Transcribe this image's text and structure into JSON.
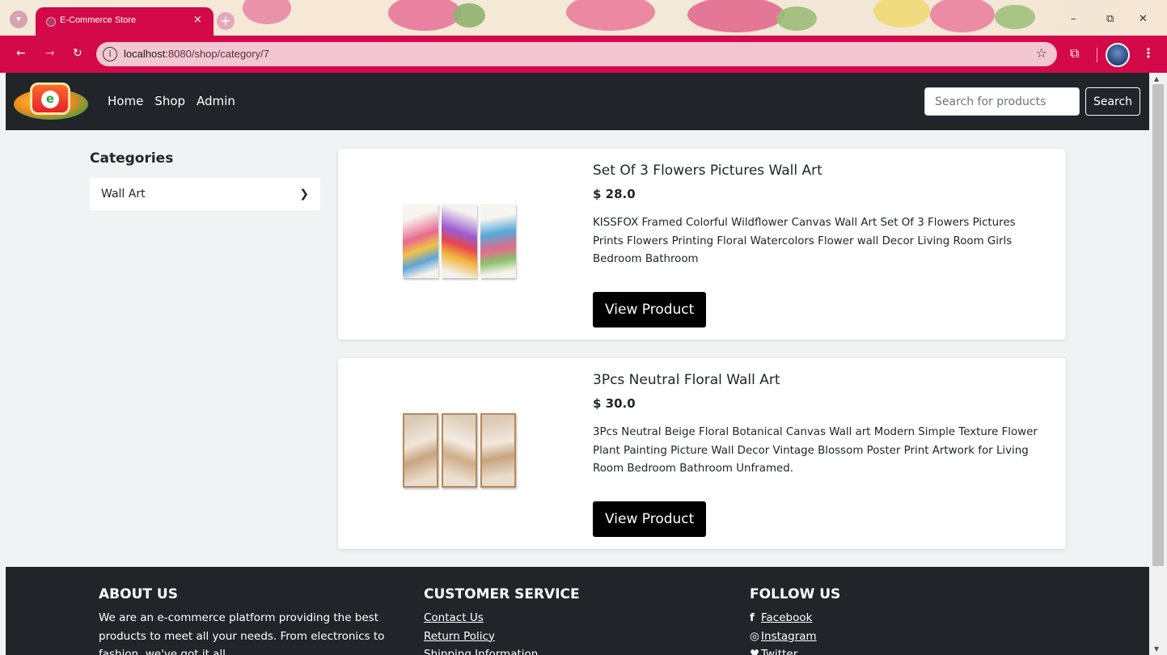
{
  "browser": {
    "tab_title": "E-Commerce Store",
    "tab_close": "×",
    "new_tab": "+",
    "url_host": "localhost",
    "url_rest": ":8080/shop/category/7",
    "minimize": "–",
    "restore": "⧉",
    "close": "✕"
  },
  "nav": {
    "links": [
      "Home",
      "Shop",
      "Admin"
    ],
    "search_placeholder": "Search for products",
    "search_button": "Search"
  },
  "sidebar": {
    "heading": "Categories",
    "categories": [
      "Wall Art"
    ]
  },
  "products": [
    {
      "name": "Set Of 3 Flowers Pictures Wall Art",
      "price": "$ 28.0",
      "description": "KISSFOX Framed Colorful Wildflower Canvas Wall Art Set Of 3 Flowers Pictures Prints Flowers Printing Floral Watercolors Flower wall Decor Living Room Girls Bedroom Bathroom",
      "button": "View Product"
    },
    {
      "name": "3Pcs Neutral Floral Wall Art",
      "price": "$ 30.0",
      "description": "3Pcs Neutral Beige Floral Botanical Canvas Wall art Modern Simple Texture Flower Plant Painting Picture Wall Decor Vintage Blossom Poster Print Artwork for Living Room Bedroom Bathroom Unframed.",
      "button": "View Product"
    }
  ],
  "footer": {
    "about": {
      "heading": "ABOUT US",
      "text": "We are an e-commerce platform providing the best products to meet all your needs. From electronics to fashion, we've got it all."
    },
    "service": {
      "heading": "CUSTOMER SERVICE",
      "links": [
        "Contact Us",
        "Return Policy",
        "Shipping Information"
      ]
    },
    "follow": {
      "heading": "FOLLOW US",
      "links": [
        "Facebook",
        "Instagram",
        "Twitter"
      ]
    }
  },
  "colors": {
    "browser_accent": "#d3094a",
    "navbar": "#212529",
    "page_bg": "#f1f2f4",
    "button": "#000000"
  }
}
